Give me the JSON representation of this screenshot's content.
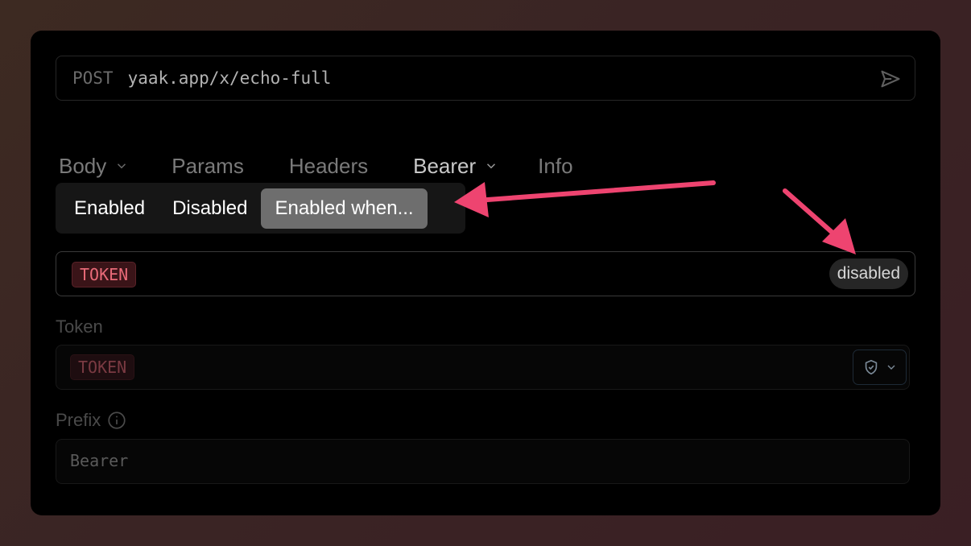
{
  "request": {
    "method": "POST",
    "url": "yaak.app/x/echo-full"
  },
  "tabs": [
    {
      "label": "Body"
    },
    {
      "label": "Params"
    },
    {
      "label": "Headers"
    },
    {
      "label": "Bearer"
    },
    {
      "label": "Info"
    }
  ],
  "enable_mode": {
    "options": [
      "Enabled",
      "Disabled",
      "Enabled when..."
    ],
    "selected": "Enabled when..."
  },
  "condition": {
    "variable": "TOKEN",
    "status": "disabled"
  },
  "token_field": {
    "label": "Token",
    "value": "TOKEN"
  },
  "prefix_field": {
    "label": "Prefix",
    "value": "Bearer"
  },
  "colors": {
    "annotation_arrow": "#ee4470",
    "token_tag_text": "#e86a78"
  }
}
